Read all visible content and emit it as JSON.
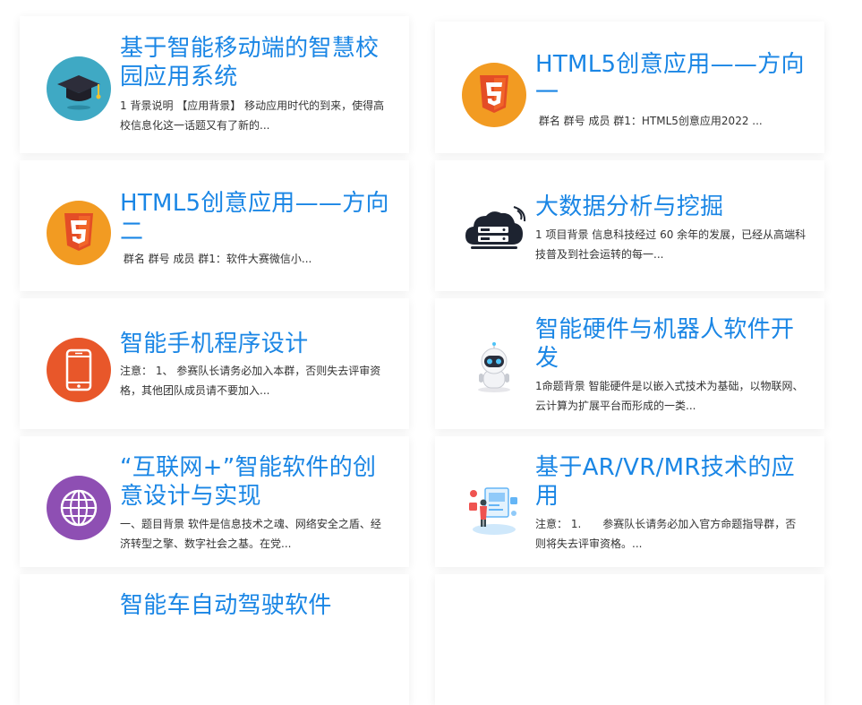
{
  "cards": [
    {
      "title": "基于智能移动端的智慧校园应用系统",
      "desc": "1 背景说明 【应用背景】 移动应用时代的到来，使得高校信息化这一话题又有了新的...",
      "icon": "graduation-cap-icon"
    },
    {
      "title": "HTML5创意应用——方向一",
      "desc": " 群名 群号 成员 群1：HTML5创意应用2022 ...",
      "icon": "html5-icon"
    },
    {
      "title": "HTML5创意应用——方向二",
      "desc": " 群名 群号 成员 群1：软件大赛微信小...",
      "icon": "html5-icon"
    },
    {
      "title": "大数据分析与挖掘",
      "desc": "1 项目背景 信息科技经过 60 余年的发展，已经从高端科技普及到社会运转的每一...",
      "icon": "cloud-server-icon"
    },
    {
      "title": "智能手机程序设计",
      "desc": "注意： 1、 参赛队长请务必加入本群，否则失去评审资格，其他团队成员请不要加入...",
      "icon": "smartphone-icon"
    },
    {
      "title": "智能硬件与机器人软件开发",
      "desc": "1命题背景 智能硬件是以嵌入式技术为基础，以物联网、云计算为扩展平台而形成的一类...",
      "icon": "robot-icon"
    },
    {
      "title": "“互联网+”智能软件的创意设计与实现",
      "desc": "一、题目背景 软件是信息技术之魂、网络安全之盾、经济转型之擎、数字社会之基。在党...",
      "icon": "globe-icon"
    },
    {
      "title": "基于AR/VR/MR技术的应用",
      "desc": "注意： 1.　　参赛队长请务必加入官方命题指导群，否则将失去评审资格。...",
      "icon": "ar-vr-icon"
    },
    {
      "title": "智能车自动驾驶软件",
      "desc": "",
      "icon": "car-icon"
    },
    {
      "title": "",
      "desc": "",
      "icon": ""
    }
  ]
}
